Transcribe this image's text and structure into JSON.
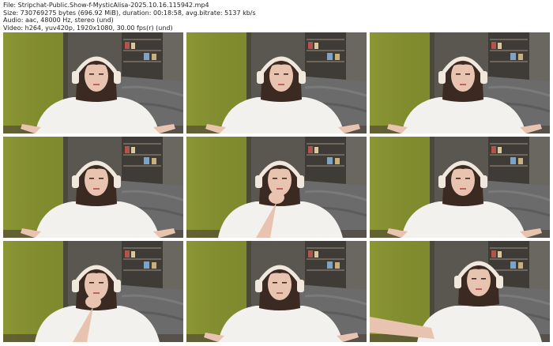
{
  "header": {
    "file": "File: Stripchat-Public.Show-f-MysticAlisa-2025.10.16.115942.mp4",
    "size": "Size: 730769275 bytes (696.92 MiB), duration: 00:18:58, avg.bitrate: 5137 kb/s",
    "audio": "Audio: aac, 48000 Hz, stereo (und)",
    "video": "Video: h264, yuv420p, 1920x1080, 30.00 fps(r) (und)"
  },
  "colors": {
    "wall": "#7f8a2e",
    "wall_light": "#98a33c",
    "room_bg": "#5a5650",
    "bed": "#6b6b6b",
    "shirt": "#f2f1ee",
    "hair": "#3b2a22",
    "skin": "#e8c3b0",
    "headphones": "#f1e8dd"
  },
  "thumbnails": [
    {
      "name": "thumbnail-frame-1",
      "variant": "a"
    },
    {
      "name": "thumbnail-frame-2",
      "variant": "b"
    },
    {
      "name": "thumbnail-frame-3",
      "variant": "a"
    },
    {
      "name": "thumbnail-frame-4",
      "variant": "a"
    },
    {
      "name": "thumbnail-frame-5",
      "variant": "c"
    },
    {
      "name": "thumbnail-frame-6",
      "variant": "a"
    },
    {
      "name": "thumbnail-frame-7",
      "variant": "c"
    },
    {
      "name": "thumbnail-frame-8",
      "variant": "a"
    },
    {
      "name": "thumbnail-frame-9",
      "variant": "d"
    }
  ]
}
